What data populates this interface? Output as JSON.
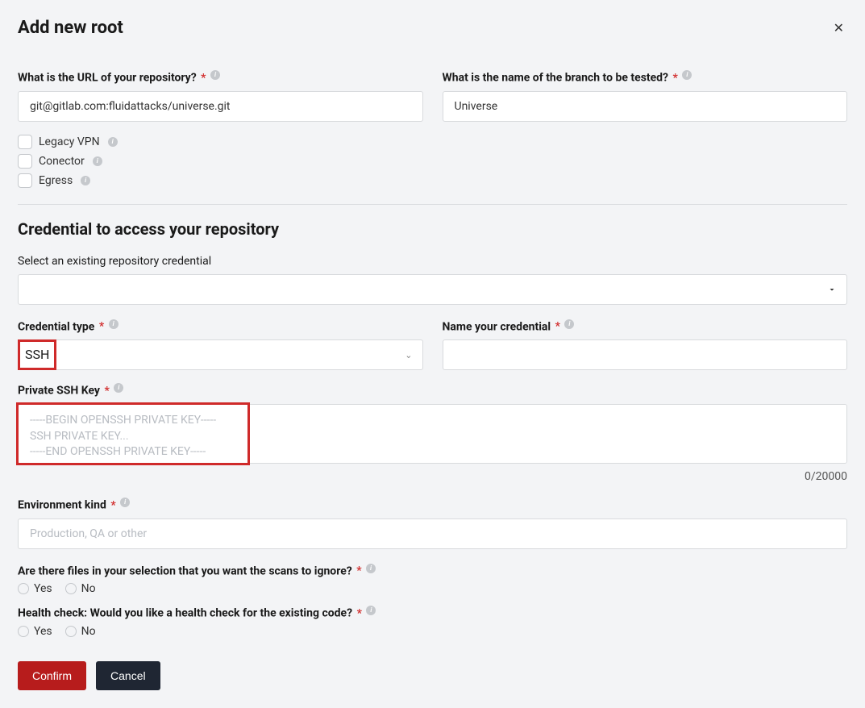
{
  "modal": {
    "title": "Add new root"
  },
  "repo": {
    "url_label": "What is the URL of your repository?",
    "url_value": "git@gitlab.com:fluidattacks/universe.git",
    "branch_label": "What is the name of the branch to be tested?",
    "branch_value": "Universe"
  },
  "options": {
    "legacy_vpn": "Legacy VPN",
    "conector": "Conector",
    "egress": "Egress"
  },
  "cred": {
    "section_title": "Credential to access your repository",
    "existing_label": "Select an existing repository credential",
    "type_label": "Credential type",
    "type_value": "SSH",
    "name_label": "Name your credential",
    "ssh_label": "Private SSH Key",
    "ssh_placeholder": "-----BEGIN OPENSSH PRIVATE KEY-----\nSSH PRIVATE KEY...\n-----END OPENSSH PRIVATE KEY-----",
    "counter": "0/20000"
  },
  "env": {
    "label": "Environment kind",
    "placeholder": "Production, QA or other"
  },
  "ignore": {
    "question": "Are there files in your selection that you want the scans to ignore?",
    "yes": "Yes",
    "no": "No"
  },
  "health": {
    "question": "Health check: Would you like a health check for the existing code?",
    "yes": "Yes",
    "no": "No"
  },
  "buttons": {
    "confirm": "Confirm",
    "cancel": "Cancel"
  }
}
